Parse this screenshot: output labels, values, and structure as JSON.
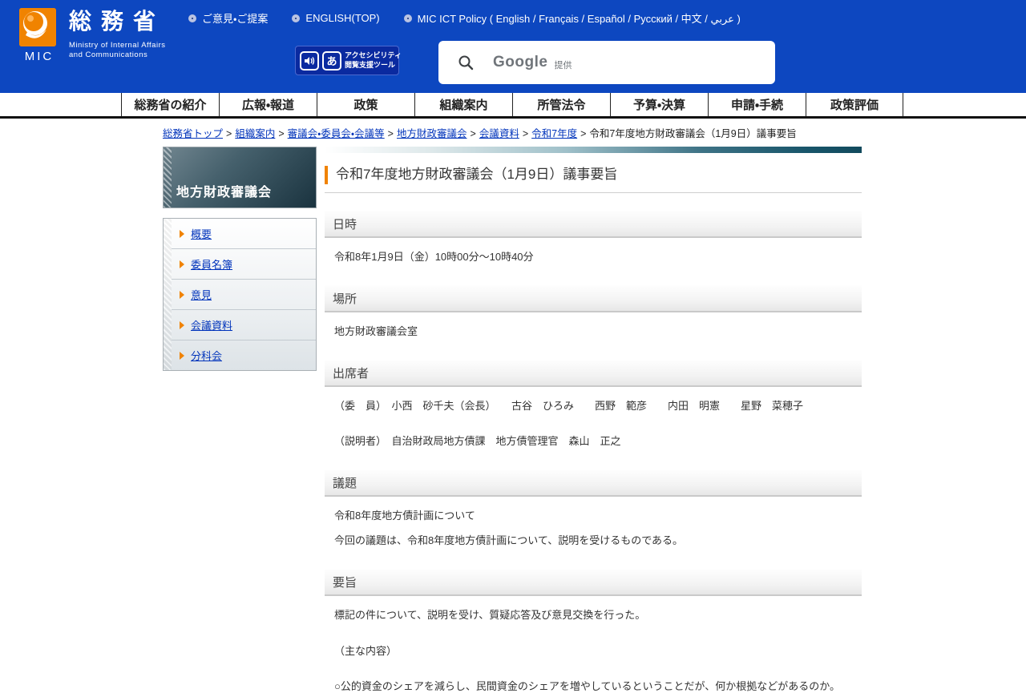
{
  "colors": {
    "header_blue": "#0d47c0",
    "accent_orange": "#f08300",
    "teal_dark": "#18556a",
    "link_blue": "#0033bb",
    "nav_border_black": "#111111"
  },
  "header": {
    "logo": {
      "mic": "MIC",
      "title_jp": "総務省",
      "subtitle_line1": "Ministry of Internal Affairs",
      "subtitle_line2": "and Communications"
    },
    "top_links": [
      "ご意見・ご提案",
      "ENGLISH(TOP)",
      "MIC ICT Policy ( English / Français / Español / Русский / 中文 / عربي )"
    ],
    "accessibility_tool": {
      "a_glyph": "あ",
      "label_line1": "アクセシビリティ",
      "label_line2": "閲覧支援ツール"
    },
    "search": {
      "brand": "Google",
      "provided_by": "提供"
    }
  },
  "nav": {
    "items": [
      "総務省の紹介",
      "広報・報道",
      "政策",
      "組織案内",
      "所管法令",
      "予算・決算",
      "申請・手続",
      "政策評価"
    ]
  },
  "breadcrumb": {
    "separator": ">",
    "links": [
      "総務省トップ",
      "組織案内",
      "審議会・委員会・会議等",
      "地方財政審議会",
      "会議資料",
      "令和7年度"
    ],
    "current": "令和7年度地方財政審議会（1月9日）議事要旨"
  },
  "sidebar": {
    "title": "地方財政審議会",
    "items": [
      "概要",
      "委員名簿",
      "意見",
      "会議資料",
      "分科会"
    ]
  },
  "main": {
    "page_title": "令和7年度地方財政審議会（1月9日）議事要旨",
    "sections": [
      {
        "heading": "日時",
        "lines": [
          "令和8年1月9日（金）10時00分～10時40分"
        ]
      },
      {
        "heading": "場所",
        "lines": [
          "地方財政審議会室"
        ]
      },
      {
        "heading": "出席者",
        "lines": [
          "（委　員）　小西　砂千夫（会長）　　古谷　ひろみ　　西野　範彦　　内田　明憲　　星野　菜穂子",
          "（説明者）　自治財政局地方債課　地方債管理官　森山　正之"
        ]
      },
      {
        "heading": "議題",
        "lines": [
          "令和8年度地方債計画について",
          "今回の議題は、令和8年度地方債計画について、説明を受けるものである。"
        ]
      },
      {
        "heading": "要旨",
        "lines": [
          "標記の件について、説明を受け、質疑応答及び意見交換を行った。",
          "（主な内容）",
          "○公的資金のシェアを減らし、民間資金のシェアを増やしているということだが、何か根拠などがあるのか。"
        ]
      }
    ]
  }
}
